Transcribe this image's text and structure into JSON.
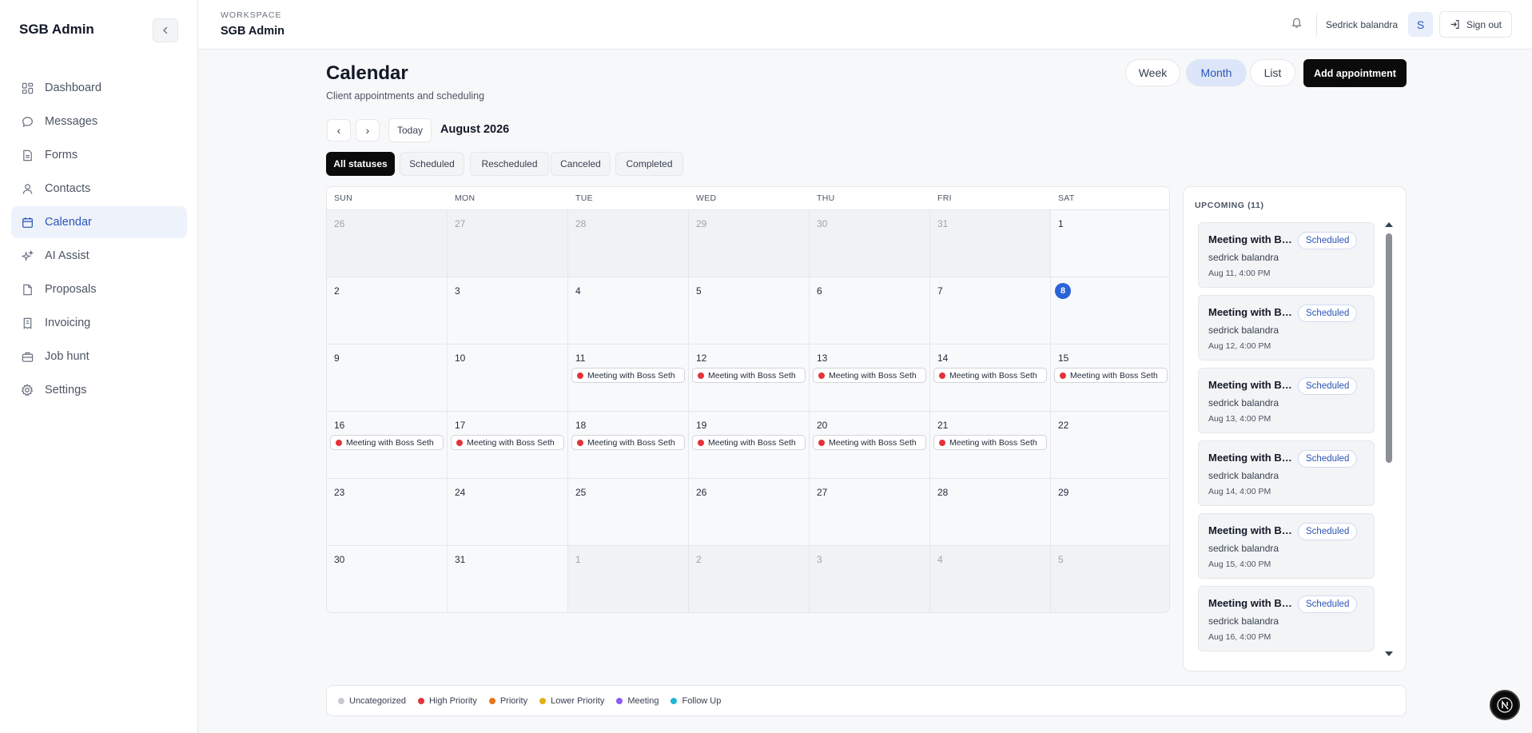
{
  "app": {
    "brand": "SGB Admin"
  },
  "sidebar": {
    "items": [
      {
        "label": "Dashboard",
        "icon": "dashboard-icon"
      },
      {
        "label": "Messages",
        "icon": "message-icon"
      },
      {
        "label": "Forms",
        "icon": "form-icon"
      },
      {
        "label": "Contacts",
        "icon": "user-icon"
      },
      {
        "label": "Calendar",
        "icon": "calendar-icon",
        "active": true
      },
      {
        "label": "AI Assist",
        "icon": "sparkles-icon"
      },
      {
        "label": "Proposals",
        "icon": "document-icon"
      },
      {
        "label": "Invoicing",
        "icon": "receipt-icon"
      },
      {
        "label": "Job hunt",
        "icon": "briefcase-icon"
      },
      {
        "label": "Settings",
        "icon": "gear-icon"
      }
    ]
  },
  "header": {
    "workspace_label": "WORKSPACE",
    "workspace_name": "SGB Admin",
    "user_name": "Sedrick balandra",
    "avatar_initial": "S",
    "signout_label": "Sign out"
  },
  "page": {
    "title": "Calendar",
    "subtitle": "Client appointments and scheduling",
    "views": [
      "Week",
      "Month",
      "List"
    ],
    "active_view": "Month",
    "add_label": "Add appointment",
    "prev": "‹",
    "next": "›",
    "today_label": "Today",
    "month_label": "August 2026",
    "filters": [
      "All statuses",
      "Scheduled",
      "Rescheduled",
      "Canceled",
      "Completed"
    ],
    "active_filter": "All statuses"
  },
  "calendar": {
    "days_of_week": [
      "SUN",
      "MON",
      "TUE",
      "WED",
      "THU",
      "FRI",
      "SAT"
    ],
    "today": "8",
    "weeks": [
      [
        {
          "d": "26",
          "other": true
        },
        {
          "d": "27",
          "other": true
        },
        {
          "d": "28",
          "other": true
        },
        {
          "d": "29",
          "other": true
        },
        {
          "d": "30",
          "other": true
        },
        {
          "d": "31",
          "other": true
        },
        {
          "d": "1"
        }
      ],
      [
        {
          "d": "2"
        },
        {
          "d": "3"
        },
        {
          "d": "4"
        },
        {
          "d": "5"
        },
        {
          "d": "6"
        },
        {
          "d": "7"
        },
        {
          "d": "8",
          "today": true
        }
      ],
      [
        {
          "d": "9"
        },
        {
          "d": "10"
        },
        {
          "d": "11",
          "event": "Meeting with Boss Seth"
        },
        {
          "d": "12",
          "event": "Meeting with Boss Seth"
        },
        {
          "d": "13",
          "event": "Meeting with Boss Seth"
        },
        {
          "d": "14",
          "event": "Meeting with Boss Seth"
        },
        {
          "d": "15",
          "event": "Meeting with Boss Seth"
        }
      ],
      [
        {
          "d": "16",
          "event": "Meeting with Boss Seth"
        },
        {
          "d": "17",
          "event": "Meeting with Boss Seth"
        },
        {
          "d": "18",
          "event": "Meeting with Boss Seth"
        },
        {
          "d": "19",
          "event": "Meeting with Boss Seth"
        },
        {
          "d": "20",
          "event": "Meeting with Boss Seth"
        },
        {
          "d": "21",
          "event": "Meeting with Boss Seth"
        },
        {
          "d": "22"
        }
      ],
      [
        {
          "d": "23"
        },
        {
          "d": "24"
        },
        {
          "d": "25"
        },
        {
          "d": "26"
        },
        {
          "d": "27"
        },
        {
          "d": "28"
        },
        {
          "d": "29"
        }
      ],
      [
        {
          "d": "30"
        },
        {
          "d": "31"
        },
        {
          "d": "1",
          "other": true
        },
        {
          "d": "2",
          "other": true
        },
        {
          "d": "3",
          "other": true
        },
        {
          "d": "4",
          "other": true
        },
        {
          "d": "5",
          "other": true
        }
      ]
    ],
    "event_color": "#e5323b"
  },
  "upcoming": {
    "title": "UPCOMING (11)",
    "items": [
      {
        "title": "Meeting with Boss Seth",
        "status": "Scheduled",
        "who": "sedrick balandra",
        "when": "Aug 11, 4:00 PM"
      },
      {
        "title": "Meeting with Boss Seth",
        "status": "Scheduled",
        "who": "sedrick balandra",
        "when": "Aug 12, 4:00 PM"
      },
      {
        "title": "Meeting with Boss Seth",
        "status": "Scheduled",
        "who": "sedrick balandra",
        "when": "Aug 13, 4:00 PM"
      },
      {
        "title": "Meeting with Boss Seth",
        "status": "Scheduled",
        "who": "sedrick balandra",
        "when": "Aug 14, 4:00 PM"
      },
      {
        "title": "Meeting with Boss Seth",
        "status": "Scheduled",
        "who": "sedrick balandra",
        "when": "Aug 15, 4:00 PM"
      },
      {
        "title": "Meeting with Boss Seth",
        "status": "Scheduled",
        "who": "sedrick balandra",
        "when": "Aug 16, 4:00 PM"
      }
    ]
  },
  "legend": [
    {
      "label": "Uncategorized",
      "color": "#c7c9cd"
    },
    {
      "label": "High Priority",
      "color": "#e5323b"
    },
    {
      "label": "Priority",
      "color": "#e8751a"
    },
    {
      "label": "Lower Priority",
      "color": "#e2b018"
    },
    {
      "label": "Meeting",
      "color": "#8b5cf6"
    },
    {
      "label": "Follow Up",
      "color": "#1fb6d4"
    }
  ],
  "colors": {
    "accent": "#2b54b8",
    "primary_button": "#0b0b0c"
  }
}
